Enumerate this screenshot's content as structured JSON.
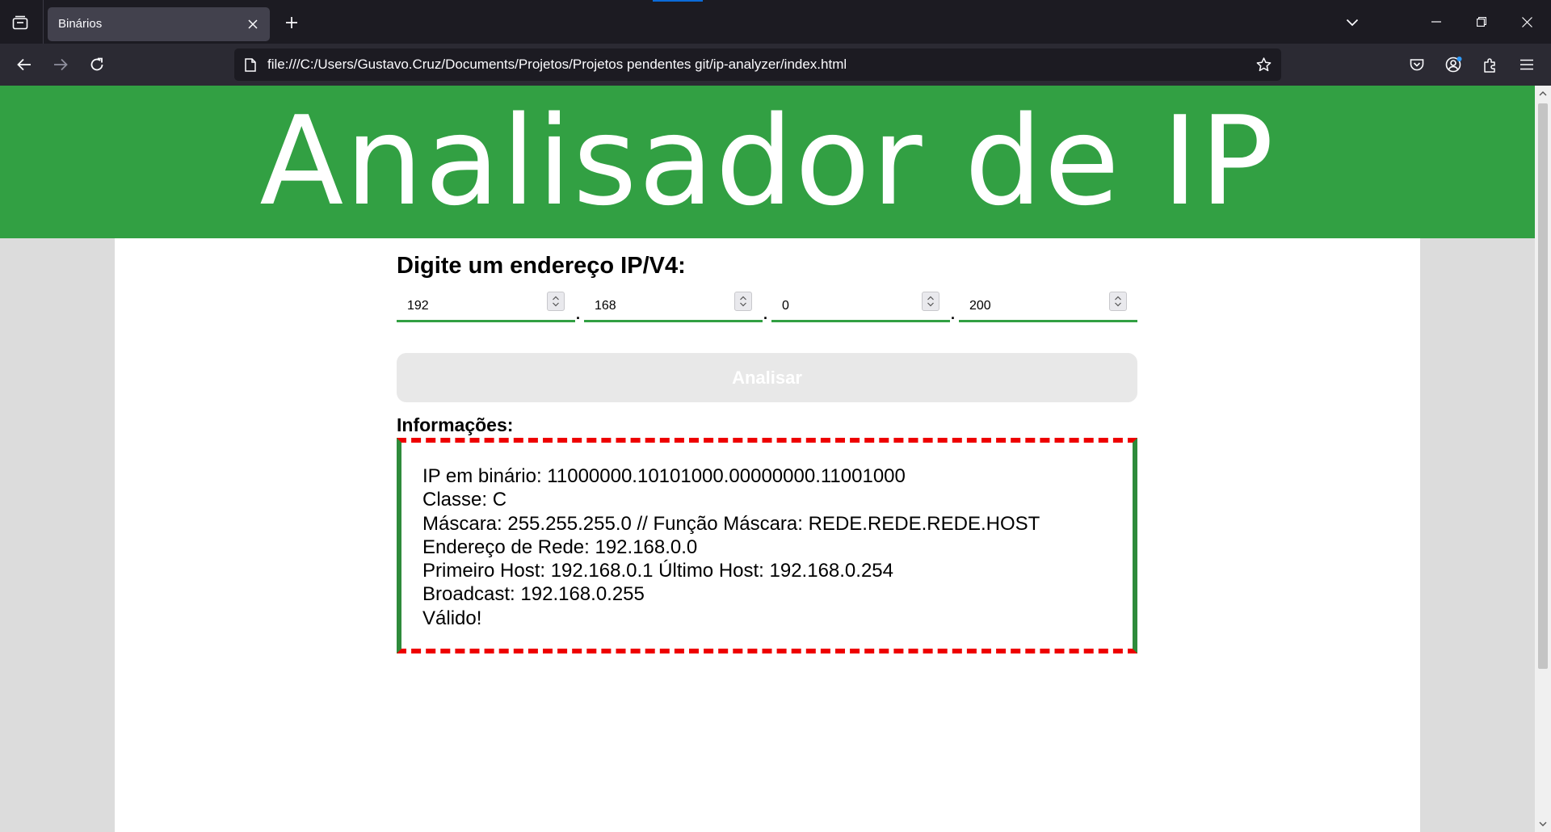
{
  "browser": {
    "tab_title": "Binários",
    "url": "file:///C:/Users/Gustavo.Cruz/Documents/Projetos/Projetos pendentes git/ip-analyzer/index.html",
    "icons": [
      "tab-list-icon",
      "close-icon",
      "plus-icon",
      "chevron-down-icon",
      "minimize-icon",
      "restore-icon",
      "window-close-icon",
      "back-arrow-icon",
      "forward-arrow-icon",
      "reload-icon",
      "page-icon",
      "star-icon",
      "pocket-icon",
      "account-icon",
      "extensions-icon",
      "menu-icon"
    ]
  },
  "page": {
    "title": "Analisador de IP",
    "prompt": "Digite um endereço IP/V4:",
    "octets": [
      "192",
      "168",
      "0",
      "200"
    ],
    "separator": ".",
    "analyze_label": "Analisar",
    "info_label": "Informações:",
    "info_lines": [
      "IP em binário: 11000000.10101000.00000000.11001000",
      "Classe: C",
      "Máscara: 255.255.255.0 // Função Máscara: REDE.REDE.REDE.HOST",
      "Endereço de Rede: 192.168.0.0",
      "Primeiro Host: 192.168.0.1 Último Host: 192.168.0.254",
      "Broadcast: 192.168.0.255",
      "Válido!"
    ]
  },
  "colors": {
    "header_green": "#32a043",
    "info_border_red": "#ee0000",
    "info_border_green": "#2e8b3b",
    "button_disabled": "#e8e8e8"
  }
}
